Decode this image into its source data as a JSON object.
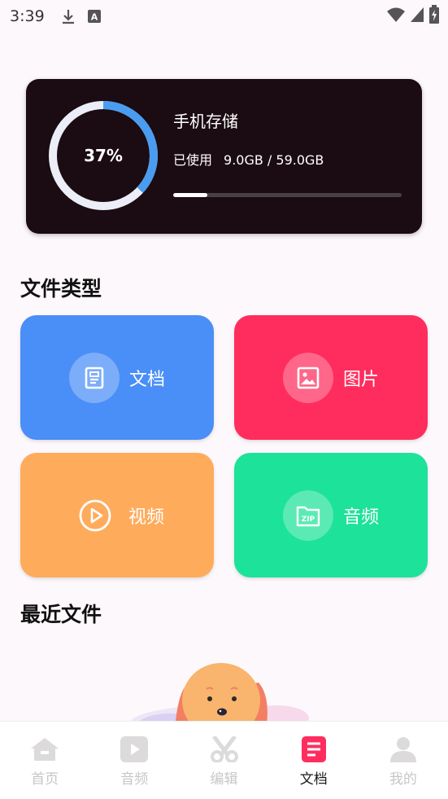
{
  "status_bar": {
    "time": "3:39",
    "icons": [
      "download-icon",
      "text-a-icon"
    ],
    "right_icons": [
      "wifi-icon",
      "signal-icon",
      "battery-charging-icon"
    ]
  },
  "storage": {
    "percent_label": "37%",
    "percent_value": 37,
    "title": "手机存储",
    "used_label": "已使用",
    "used_value": "9.0GB / 59.0GB",
    "bar_fraction": 0.15,
    "colors": {
      "ring_fill": "#4a9cf0",
      "ring_track": "#eceef7",
      "card_bg": "#1b0b12"
    }
  },
  "file_types": {
    "title": "文件类型",
    "tiles": [
      {
        "label": "文档",
        "icon": "document-icon",
        "color": "#4a8ef7"
      },
      {
        "label": "图片",
        "icon": "image-icon",
        "color": "#ff2d5e"
      },
      {
        "label": "视频",
        "icon": "play-circle-icon",
        "color": "#ffab5c"
      },
      {
        "label": "音频",
        "icon": "zip-icon",
        "color": "#1de29a"
      }
    ]
  },
  "recent": {
    "title": "最近文件",
    "illustration": "dog-illustration"
  },
  "bottom_nav": {
    "items": [
      {
        "label": "首页",
        "icon": "home-icon",
        "active": false
      },
      {
        "label": "音频",
        "icon": "play-icon",
        "active": false
      },
      {
        "label": "编辑",
        "icon": "scissors-icon",
        "active": false
      },
      {
        "label": "文档",
        "icon": "document-list-icon",
        "active": true
      },
      {
        "label": "我的",
        "icon": "user-icon",
        "active": false
      }
    ],
    "active_color": "#ff2d5e",
    "inactive_color": "#dcdadb"
  }
}
